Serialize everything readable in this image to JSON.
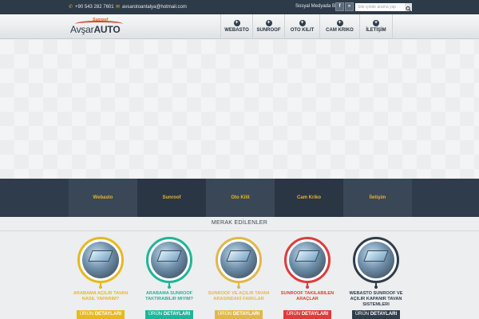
{
  "topbar": {
    "phone": "+90 543 282 7601",
    "email": "avsarotoantalya@hotmail.com",
    "social_label": "Sosyal Medyada Biz",
    "social_buttons": [
      "f",
      "»"
    ],
    "search_placeholder": "Site içinde arama yap"
  },
  "logo": {
    "small": "Sunroof",
    "name_light": "Avşar",
    "name_bold": "AUTO"
  },
  "nav": [
    "WEBASTO",
    "SUNROOF",
    "OTO KILIT",
    "CAM KRIKO",
    "İLETİŞİM"
  ],
  "strip": [
    "Webasto",
    "Sunroof",
    "Oto Kilit",
    "Cam Kriko",
    "İletişim"
  ],
  "section_title": "MERAK EDİLENLER",
  "cards": [
    {
      "title": "ARABAMA AÇILIR TAVAN NASIL YAPARIM?",
      "button_light": "ÜRÜN",
      "button_bold": "DETAYLARI",
      "color": "#e6b91e"
    },
    {
      "title": "ARABAMA SUNROOF TAKTIRABILIR MIYIM?",
      "button_light": "ÜRÜN",
      "button_bold": "DETAYLARI",
      "color": "#1fb59a"
    },
    {
      "title": "SUNROOF VE AÇILIR TAVAN ARASINDAKİ FARKLAR",
      "button_light": "ÜRÜN",
      "button_bold": "DETAYLARI",
      "color": "#e0b848"
    },
    {
      "title": "SUNROOF TAKILABILEN ARAÇLAR",
      "button_light": "ÜRÜN",
      "button_bold": "DETAYLARI",
      "color": "#de3b3b"
    },
    {
      "title": "WEBASTO SUNROOF VE AÇILIR KAPANIR TAVAN SISTEMLERI",
      "button_light": "ÜRÜN",
      "button_bold": "DETAYLARI",
      "color": "#2f3d4b"
    }
  ],
  "colors": {
    "accent": "#e8b425",
    "dark": "#2f3c4b"
  }
}
